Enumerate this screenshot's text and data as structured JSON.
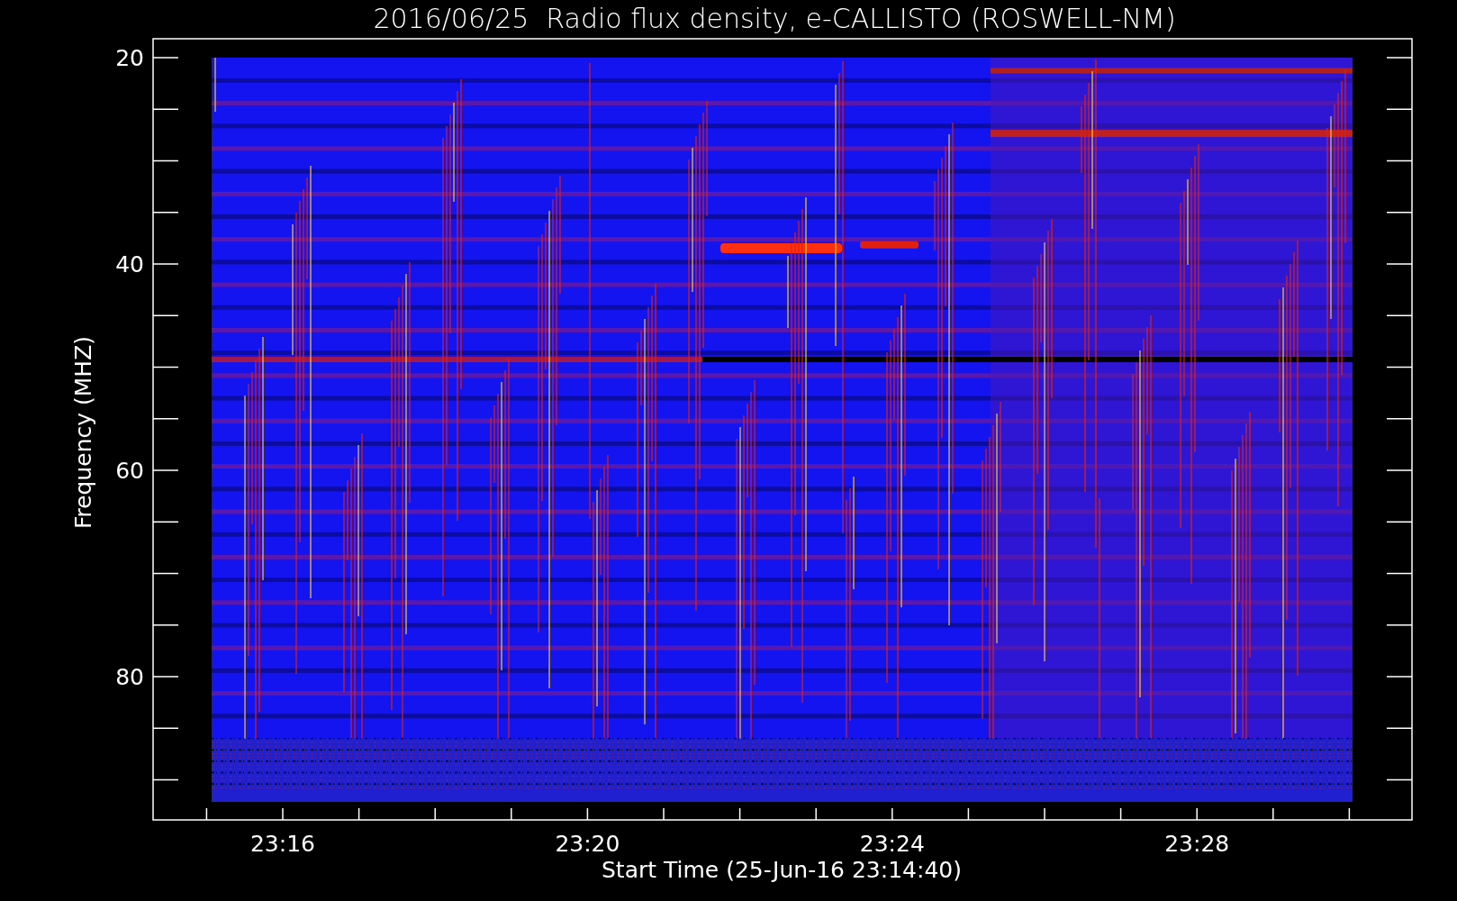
{
  "title": "2016/06/25  Radio flux density, e-CALLISTO (ROSWELL-NM)",
  "y_axis": {
    "label": "Frequency (MHZ)",
    "ticks": [
      "20",
      "40",
      "60",
      "80"
    ]
  },
  "x_axis": {
    "label": "Start Time (25-Jun-16 23:14:40)",
    "ticks": [
      "23:16",
      "23:20",
      "23:24",
      "23:28"
    ]
  }
}
